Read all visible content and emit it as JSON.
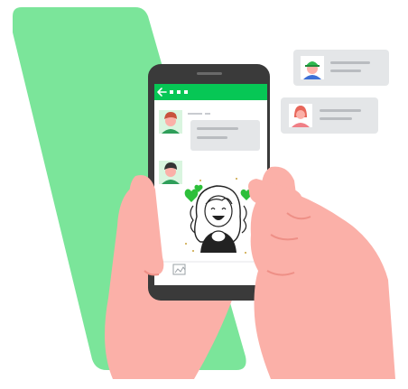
{
  "illustration": {
    "colors": {
      "accent_green": "#7be59a",
      "line_green": "#06c755",
      "skin": "#fbb0a8",
      "skin_shadow": "#ee8f86",
      "phone_body": "#3a3a3a",
      "bubble_gray": "#e4e6e8",
      "chat_bg": "#ffffff"
    },
    "phone": {
      "header_icon": "back-arrow-icon",
      "header_dots": 3,
      "input_icons": [
        "image-icon"
      ]
    },
    "floating_messages": [
      {
        "avatar": "green-cap-man-avatar-icon"
      },
      {
        "avatar": "red-hair-woman-avatar-icon"
      }
    ],
    "chat_messages": [
      {
        "avatar": "red-hair-man-avatar-icon",
        "kind": "text-bubble"
      },
      {
        "avatar": "dark-hair-man-avatar-icon",
        "kind": "sticker"
      }
    ],
    "sticker": {
      "icon": "cheerful-girl-sticker-icon",
      "decorations": [
        "green-heart-icon",
        "green-heart-icon",
        "green-heart-icon"
      ]
    }
  }
}
